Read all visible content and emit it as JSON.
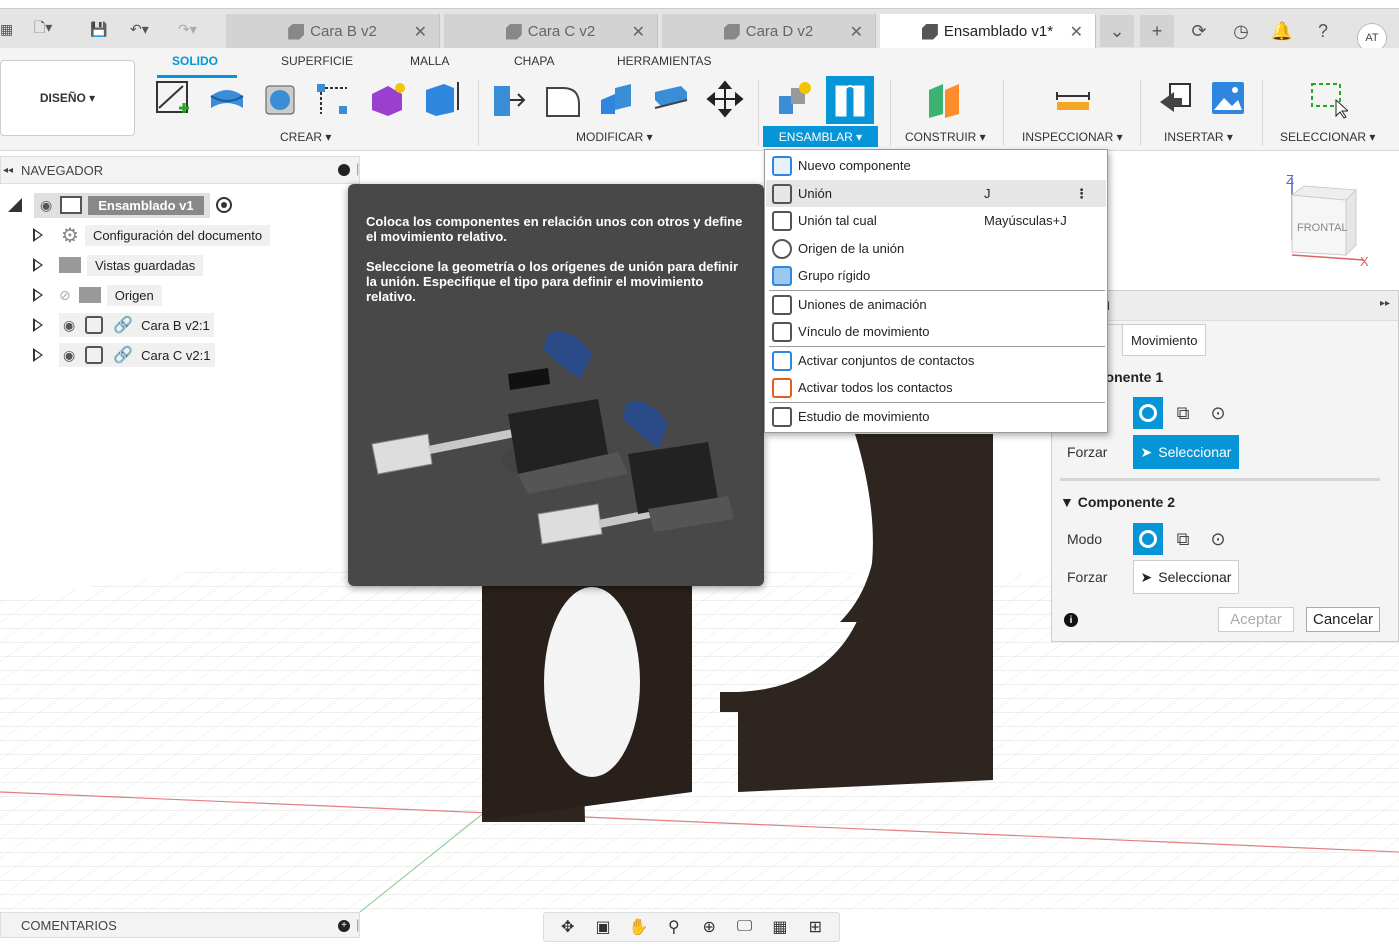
{
  "tabs": [
    {
      "label": "Cara B v2"
    },
    {
      "label": "Cara C v2"
    },
    {
      "label": "Cara D v2"
    },
    {
      "label": "Ensamblado v1*"
    }
  ],
  "user_initials": "AT",
  "design_button": "DISEÑO ▾",
  "ribbon_tabs": [
    "SOLIDO",
    "SUPERFICIE",
    "MALLA",
    "CHAPA",
    "HERRAMIENTAS"
  ],
  "groups": {
    "crear": "CREAR ▾",
    "modificar": "MODIFICAR ▾",
    "ensamblar": "ENSAMBLAR ▾",
    "construir": "CONSTRUIR ▾",
    "inspeccionar": "INSPECCIONAR ▾",
    "insertar": "INSERTAR ▾",
    "seleccionar": "SELECCIONAR ▾"
  },
  "navigator": {
    "title": "NAVEGADOR",
    "root": "Ensamblado v1",
    "items": [
      {
        "label": "Configuración del documento"
      },
      {
        "label": "Vistas guardadas"
      },
      {
        "label": "Origen"
      },
      {
        "label": "Cara B v2:1"
      },
      {
        "label": "Cara C v2:1"
      }
    ]
  },
  "tooltip": {
    "p1": "Coloca los componentes en relación unos con otros y define el movimiento relativo.",
    "p2": "Seleccione la geometría o los orígenes de unión para definir la unión. Especifique el tipo para definir el movimiento relativo."
  },
  "dropdown": {
    "items": [
      {
        "label": "Nuevo componente",
        "shortcut": ""
      },
      {
        "label": "Unión",
        "shortcut": "J"
      },
      {
        "label": "Unión tal cual",
        "shortcut": "Mayúsculas+J"
      },
      {
        "label": "Origen de la unión",
        "shortcut": ""
      },
      {
        "label": "Grupo rígido",
        "shortcut": ""
      },
      {
        "label": "Uniones de animación",
        "shortcut": ""
      },
      {
        "label": "Vínculo de movimiento",
        "shortcut": ""
      },
      {
        "label": "Activar conjuntos de contactos",
        "shortcut": ""
      },
      {
        "label": "Activar todos los contactos",
        "shortcut": ""
      },
      {
        "label": "Estudio de movimiento",
        "shortcut": ""
      }
    ],
    "more": "⋮"
  },
  "panel": {
    "title": "ÓN",
    "tab1": "n",
    "tab2": "Movimiento",
    "section1": "ponente 1",
    "section2": "Componente 2",
    "modo": "Modo",
    "forzar": "Forzar",
    "select_label": "Seleccionar",
    "ok": "Aceptar",
    "cancel": "Cancelar"
  },
  "viewcube": {
    "face": "FRONTAL",
    "z": "Z",
    "x": "X"
  },
  "comments": "COMENTARIOS",
  "colors": {
    "accent": "#0696d7",
    "tooltip_bg": "#484848",
    "wood": "#2e2420"
  }
}
